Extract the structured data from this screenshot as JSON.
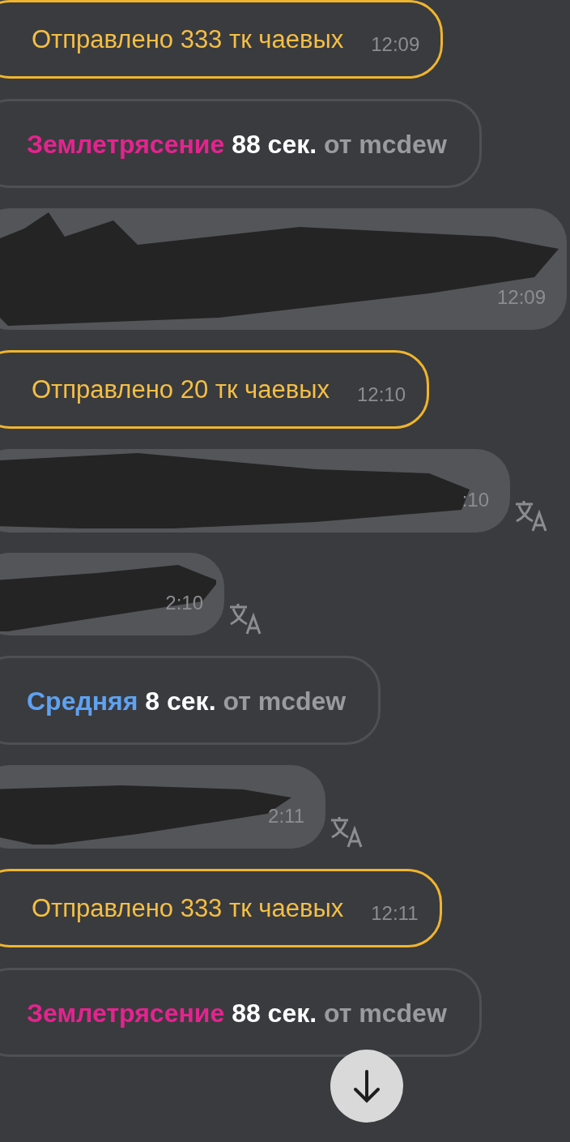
{
  "messages": [
    {
      "kind": "tip",
      "text": "Отправлено 333 тк чаевых",
      "time": "12:09"
    },
    {
      "kind": "event",
      "level": "Землетрясение",
      "color": "#e5238f",
      "duration": "88 сек.",
      "sender": "от mcdew"
    },
    {
      "kind": "redacted",
      "time": "12:09",
      "translate": false
    },
    {
      "kind": "tip",
      "text": "Отправлено 20 тк чаевых",
      "time": "12:10"
    },
    {
      "kind": "redacted",
      "time": ":10",
      "translate": true
    },
    {
      "kind": "redacted",
      "time": "2:10",
      "translate": true
    },
    {
      "kind": "event",
      "level": "Средняя",
      "color": "#5ea2f2",
      "duration": "8 сек.",
      "sender": "от mcdew"
    },
    {
      "kind": "redacted",
      "time": "2:11",
      "translate": true
    },
    {
      "kind": "tip",
      "text": "Отправлено 333 тк чаевых",
      "time": "12:11"
    },
    {
      "kind": "event",
      "level": "Землетрясение",
      "color": "#e5238f",
      "duration": "88 сек.",
      "sender": "от mcdew"
    }
  ]
}
